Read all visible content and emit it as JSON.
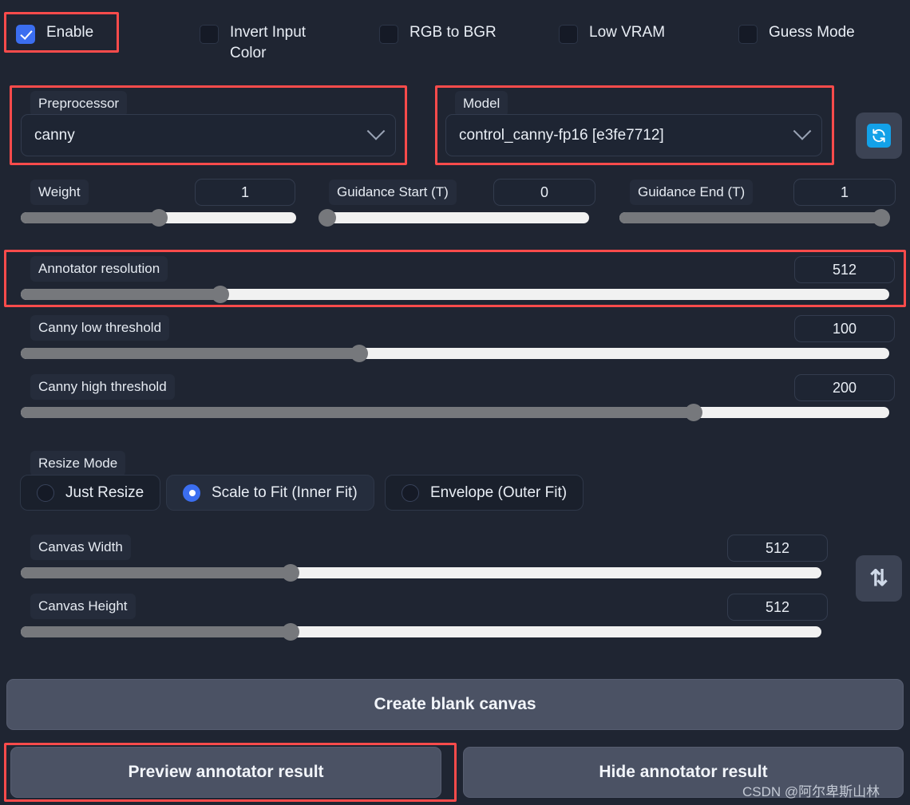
{
  "panel": {
    "background_color": "#1f2532",
    "accent_color": "#3b6ef0",
    "highlight_color": "#fb4b4b"
  },
  "checkboxes": [
    {
      "label": "Enable",
      "checked": true,
      "name": "enable"
    },
    {
      "label": "Invert Input Color",
      "checked": false,
      "name": "invert-input-color"
    },
    {
      "label": "RGB to BGR",
      "checked": false,
      "name": "rgb-to-bgr"
    },
    {
      "label": "Low VRAM",
      "checked": false,
      "name": "low-vram"
    },
    {
      "label": "Guess Mode",
      "checked": false,
      "name": "guess-mode"
    }
  ],
  "preprocessor": {
    "label": "Preprocessor",
    "value": "canny",
    "chevron_icon": "chevron-down-icon"
  },
  "model": {
    "label": "Model",
    "value": "control_canny-fp16 [e3fe7712]",
    "chevron_icon": "chevron-down-icon"
  },
  "refresh_button": {
    "icon": "refresh-icon"
  },
  "swap_button": {
    "icon": "swap-vertical-icon",
    "glyph": "⇅"
  },
  "sliders_row": [
    {
      "label": "Weight",
      "value": "1",
      "fill_pct": 50
    },
    {
      "label": "Guidance Start (T)",
      "value": "0",
      "fill_pct": 0
    },
    {
      "label": "Guidance End (T)",
      "value": "1",
      "fill_pct": 98
    }
  ],
  "sliders_full": [
    {
      "label": "Annotator resolution",
      "value": "512",
      "fill_pct": 23,
      "highlighted": true
    },
    {
      "label": "Canny low threshold",
      "value": "100",
      "fill_pct": 39,
      "highlighted": false
    },
    {
      "label": "Canny high threshold",
      "value": "200",
      "fill_pct": 78,
      "highlighted": false
    }
  ],
  "resize_mode": {
    "label": "Resize Mode",
    "options": [
      {
        "label": "Just Resize",
        "selected": false
      },
      {
        "label": "Scale to Fit (Inner Fit)",
        "selected": true
      },
      {
        "label": "Envelope (Outer Fit)",
        "selected": false
      }
    ]
  },
  "canvas_sliders": [
    {
      "label": "Canvas Width",
      "value": "512",
      "fill_pct": 34
    },
    {
      "label": "Canvas Height",
      "value": "512",
      "fill_pct": 34
    }
  ],
  "buttons": {
    "create_blank_canvas": "Create blank canvas",
    "preview_annotator_result": "Preview annotator result",
    "hide_annotator_result": "Hide annotator result"
  },
  "watermark": "CSDN @阿尔卑斯山林"
}
